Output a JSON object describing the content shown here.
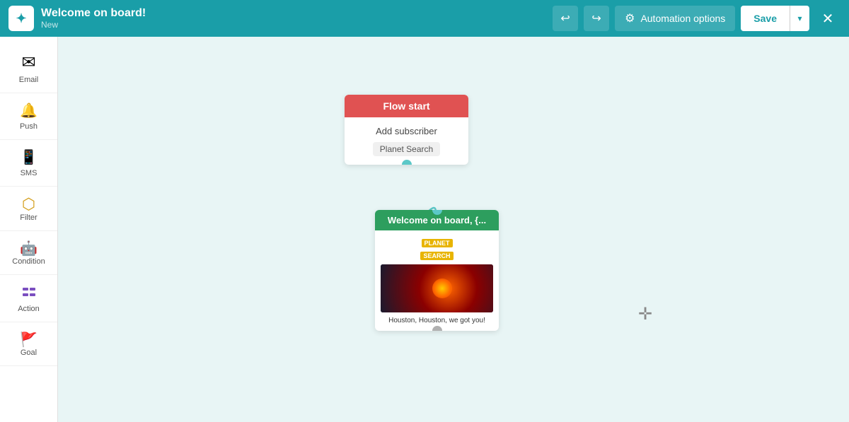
{
  "header": {
    "title": "Welcome on board!",
    "subtitle": "New",
    "undo_label": "↩",
    "redo_label": "↪",
    "automation_options_label": "Automation options",
    "save_label": "Save",
    "save_dropdown_label": "▼",
    "close_label": "✕"
  },
  "sidebar": {
    "items": [
      {
        "id": "email",
        "label": "Email",
        "icon": "✉"
      },
      {
        "id": "push",
        "label": "Push",
        "icon": "🔔"
      },
      {
        "id": "sms",
        "label": "SMS",
        "icon": "📱"
      },
      {
        "id": "filter",
        "label": "Filter",
        "icon": "⬡"
      },
      {
        "id": "condition",
        "label": "Condition",
        "icon": "🤖"
      },
      {
        "id": "action",
        "label": "Action",
        "icon": "⬛"
      },
      {
        "id": "goal",
        "label": "Goal",
        "icon": "🚩"
      }
    ]
  },
  "canvas": {
    "flow_start_node": {
      "header": "Flow start",
      "subtitle": "Add subscriber",
      "tag": "Planet Search"
    },
    "email_node": {
      "header": "Welcome on board, {...",
      "planet_label_line1": "PLANET",
      "planet_label_line2": "SEARCH",
      "caption": "Houston, Houston, we got you!"
    }
  }
}
